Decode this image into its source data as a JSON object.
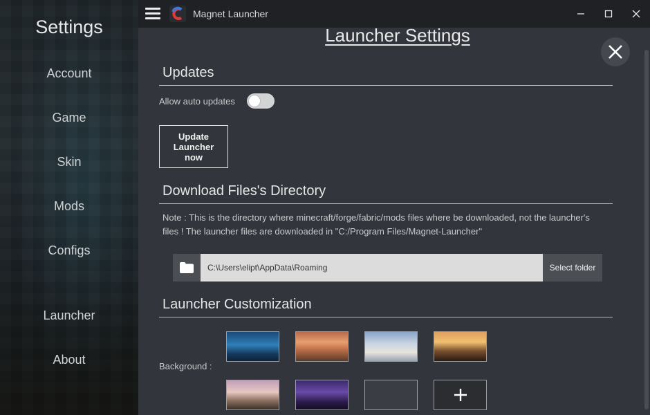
{
  "sidebar": {
    "title": "Settings",
    "items": [
      {
        "label": "Account"
      },
      {
        "label": "Game"
      },
      {
        "label": "Skin"
      },
      {
        "label": "Mods"
      },
      {
        "label": "Configs"
      },
      {
        "label": "Launcher"
      },
      {
        "label": "About"
      }
    ]
  },
  "titlebar": {
    "app_title": "Magnet Launcher",
    "menu_icon": "hamburger-menu-icon",
    "logo_icon": "magnet-logo-icon",
    "window_controls": [
      "minimize-icon",
      "maximize-icon",
      "close-icon"
    ]
  },
  "page": {
    "title": "Launcher Settings",
    "close_icon": "close-icon"
  },
  "updates": {
    "heading": "Updates",
    "auto_label": "Allow auto updates",
    "auto_enabled": false,
    "update_button": "Update Launcher now"
  },
  "directory": {
    "heading": "Download Files's Directory",
    "note": "Note : This is the directory where minecraft/forge/fabric/mods files where be downloaded, not the launcher's files ! The launcher files are downloaded in \"C:/Program Files/Magnet-Launcher\"",
    "path_value": "C:\\Users\\elipt\\AppData\\Roaming",
    "folder_icon": "folder-icon",
    "select_button": "Select folder"
  },
  "customization": {
    "heading": "Launcher Customization",
    "background_label": "Background :",
    "add_icon": "plus-icon"
  },
  "colors": {
    "sidebar_bg": "#1d2428",
    "panel_bg": "#32353b",
    "titlebar_bg": "#1f2125",
    "input_bg": "#dcdcdc",
    "button_bg": "#4b4e53"
  }
}
